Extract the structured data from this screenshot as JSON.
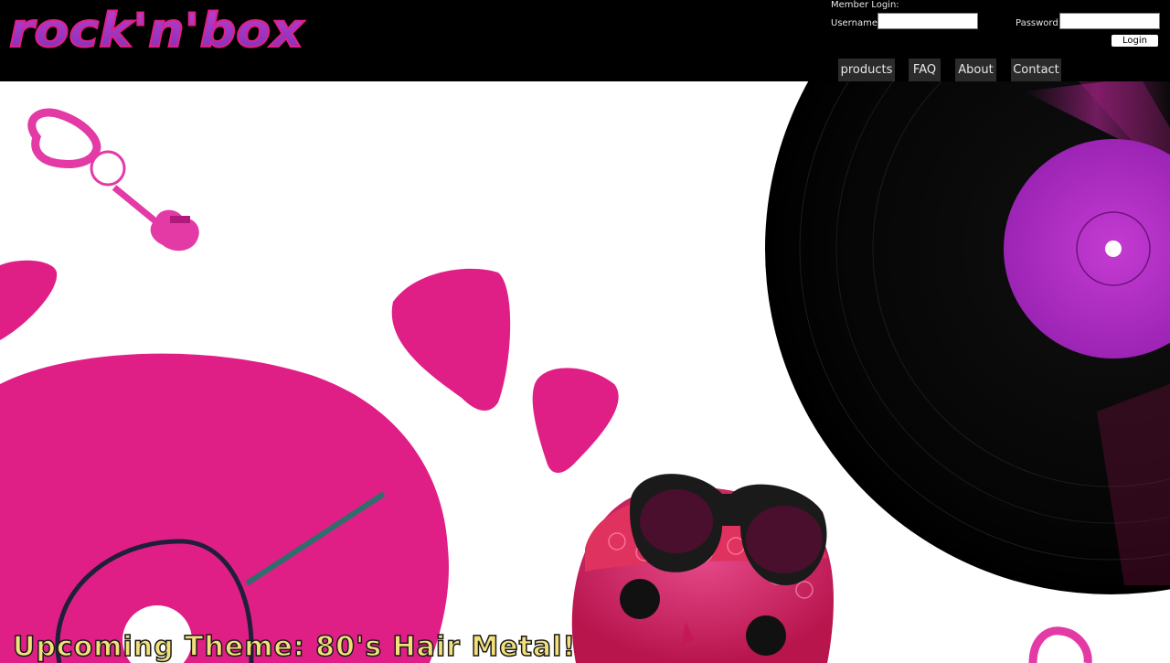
{
  "brand": {
    "logo_text": "rock'n'box"
  },
  "login": {
    "heading": "Member Login:",
    "username_label": "Username:",
    "username_value": "",
    "password_label": "Password:",
    "password_value": "",
    "login_button": "Login"
  },
  "nav": {
    "items": [
      "products",
      "FAQ",
      "About",
      "Contact"
    ]
  },
  "hero": {
    "theme_text": "Upcoming Theme: 80's Hair Metal!"
  },
  "colors": {
    "header_bg": "#000000",
    "pink": "#e01f86",
    "purple": "#b02bc6",
    "logo_fill": "#9a2bc0",
    "theme_text": "#f3e07a"
  }
}
